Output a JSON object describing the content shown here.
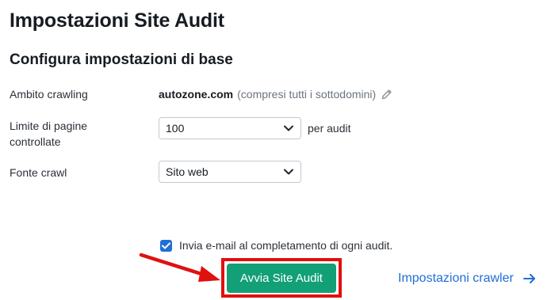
{
  "dialog": {
    "title": "Impostazioni Site Audit",
    "section_title": "Configura impostazioni di base"
  },
  "scope": {
    "label": "Ambito crawling",
    "domain": "autozone.com",
    "note": "(compresi tutti i sottodomini)",
    "edit_icon": "pencil-icon"
  },
  "page_limit": {
    "label": "Limite di pagine controllate",
    "selected": "100",
    "suffix": "per audit"
  },
  "crawl_source": {
    "label": "Fonte crawl",
    "selected": "Sito web"
  },
  "email_option": {
    "checked": true,
    "label": "Invia e-mail al completamento di ogni audit."
  },
  "actions": {
    "start_label": "Avvia Site Audit",
    "crawler_settings_label": "Impostazioni crawler"
  },
  "colors": {
    "primary_green": "#13a077",
    "link_blue": "#1f6fd6",
    "highlight_red": "#e0100f"
  }
}
